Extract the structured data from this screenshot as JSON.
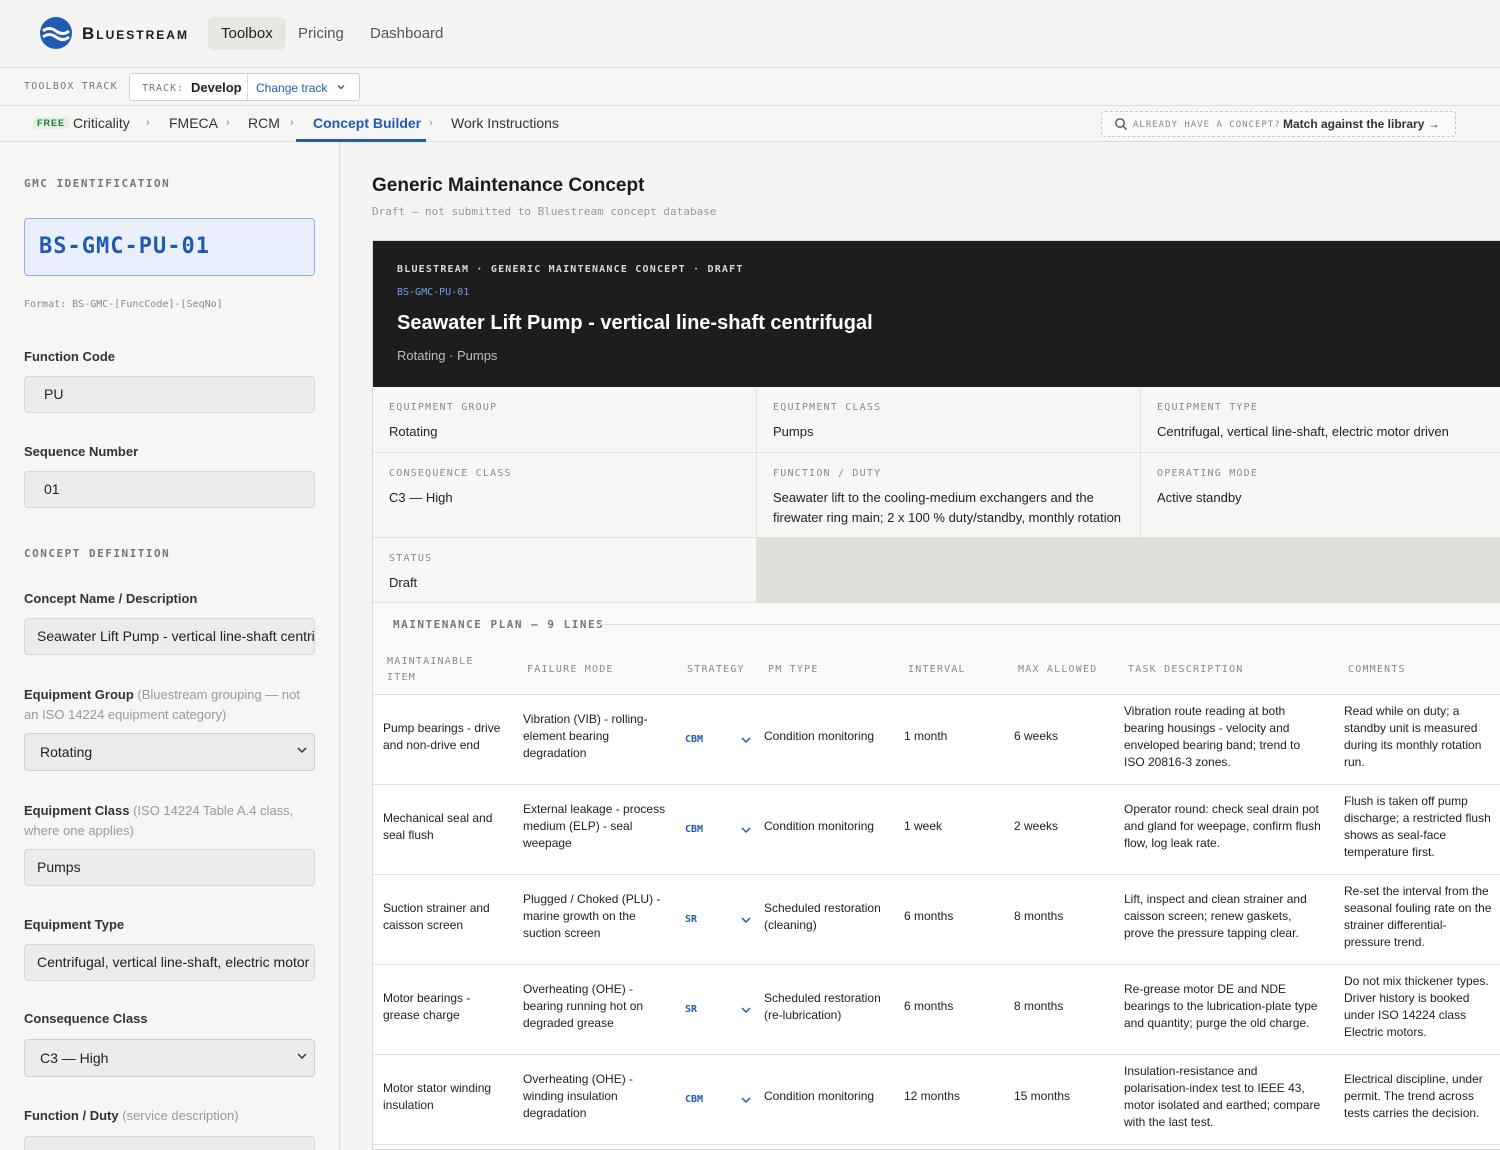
{
  "brand": {
    "name": "Bluestream",
    "accent": "#1f5bb5"
  },
  "nav": {
    "items": [
      "Toolbox",
      "Pricing",
      "Dashboard"
    ],
    "active": "Toolbox"
  },
  "track": {
    "label": "TOOLBOX TRACK",
    "key": "TRACK:",
    "value": "Develop",
    "change": "Change track",
    "chevron_icon": "chevron-down-icon"
  },
  "steps": {
    "badge": "FREE",
    "items": [
      "Criticality",
      "FMECA",
      "RCM",
      "Concept Builder",
      "Work Instructions"
    ],
    "active": "Concept Builder",
    "separator": "›",
    "match_question": "ALREADY HAVE A CONCEPT?",
    "match_link": "Match against the library →",
    "search_icon": "search-icon"
  },
  "sidebar": {
    "gmc_section": "GMC IDENTIFICATION",
    "gmc_id": "BS-GMC-PU-01",
    "format_hint": "Format: BS-GMC-[FuncCode]-[SeqNo]",
    "function_code_label": "Function Code",
    "function_code": "PU",
    "sequence_label": "Sequence Number",
    "sequence": "01",
    "concept_section": "CONCEPT DEFINITION",
    "concept_name_label": "Concept Name / Description",
    "concept_name": "Seawater Lift Pump - vertical line-shaft centrifugal",
    "group_label": "Equipment Group",
    "group_hint": "(Bluestream grouping — not an ISO 14224 equipment category)",
    "group_value": "Rotating",
    "class_label": "Equipment Class",
    "class_hint": "(ISO 14224 Table A.4 class, where one applies)",
    "class_value": "Pumps",
    "type_label": "Equipment Type",
    "type_value": "Centrifugal, vertical line-shaft, electric motor driven",
    "consequence_label": "Consequence Class",
    "consequence_value": "C3 — High",
    "function_label": "Function / Duty",
    "function_hint": "(service description)"
  },
  "main": {
    "title": "Generic Maintenance Concept",
    "subtitle": "Draft — not submitted to Bluestream concept database",
    "card": {
      "kicker": "BLUESTREAM · GENERIC MAINTENANCE CONCEPT · DRAFT",
      "id": "BS-GMC-PU-01",
      "title": "Seawater Lift Pump - vertical line-shaft centrifugal",
      "subtitle": "Rotating · Pumps"
    },
    "facts": [
      {
        "key": "EQUIPMENT GROUP",
        "value": "Rotating"
      },
      {
        "key": "EQUIPMENT CLASS",
        "value": "Pumps"
      },
      {
        "key": "EQUIPMENT TYPE",
        "value": "Centrifugal, vertical line-shaft, electric motor driven"
      },
      {
        "key": "CONSEQUENCE CLASS",
        "value": "C3 — High"
      },
      {
        "key": "FUNCTION / DUTY",
        "value": "Seawater lift to the cooling-medium exchangers and the firewater ring main; 2 x 100 % duty/standby, monthly rotation"
      },
      {
        "key": "OPERATING MODE",
        "value": "Active standby"
      },
      {
        "key": "STATUS",
        "value": "Draft"
      }
    ],
    "plan_title": "MAINTENANCE PLAN — 9 LINES",
    "columns": [
      "MAINTAINABLE ITEM",
      "FAILURE MODE",
      "STRATEGY",
      "PM TYPE",
      "INTERVAL",
      "MAX ALLOWED",
      "TASK DESCRIPTION",
      "COMMENTS"
    ],
    "rows": [
      {
        "item": "Pump bearings - drive and non-drive end",
        "failure": "Vibration (VIB) - rolling-element bearing degradation",
        "strategy": "CBM",
        "pm": "Condition monitoring",
        "interval": "1 month",
        "max": "6 weeks",
        "task": "Vibration route reading at both bearing housings - velocity and enveloped bearing band; trend to ISO 20816-3 zones.",
        "comments": "Read while on duty; a standby unit is measured during its monthly rotation run."
      },
      {
        "item": "Mechanical seal and seal flush",
        "failure": "External leakage - process medium (ELP) - seal weepage",
        "strategy": "CBM",
        "pm": "Condition monitoring",
        "interval": "1 week",
        "max": "2 weeks",
        "task": "Operator round: check seal drain pot and gland for weepage, confirm flush flow, log leak rate.",
        "comments": "Flush is taken off pump discharge; a restricted flush shows as seal-face temperature first."
      },
      {
        "item": "Suction strainer and caisson screen",
        "failure": "Plugged / Choked (PLU) - marine growth on the suction screen",
        "strategy": "SR",
        "pm": "Scheduled restoration (cleaning)",
        "interval": "6 months",
        "max": "8 months",
        "task": "Lift, inspect and clean strainer and caisson screen; renew gaskets, prove the pressure tapping clear.",
        "comments": "Re-set the interval from the seasonal fouling rate on the strainer differential-pressure trend."
      },
      {
        "item": "Motor bearings - grease charge",
        "failure": "Overheating (OHE) - bearing running hot on degraded grease",
        "strategy": "SR",
        "pm": "Scheduled restoration (re-lubrication)",
        "interval": "6 months",
        "max": "8 months",
        "task": "Re-grease motor DE and NDE bearings to the lubrication-plate type and quantity; purge the old charge.",
        "comments": "Do not mix thickener types. Driver history is booked under ISO 14224 class Electric motors."
      },
      {
        "item": "Motor stator winding insulation",
        "failure": "Overheating (OHE) - winding insulation degradation",
        "strategy": "CBM",
        "pm": "Condition monitoring",
        "interval": "12 months",
        "max": "15 months",
        "task": "Insulation-resistance and polarisation-index test to IEEE 43, motor isolated and earthed; compare with the last test.",
        "comments": "Electrical discipline, under permit. The trend across tests carries the decision."
      }
    ]
  }
}
